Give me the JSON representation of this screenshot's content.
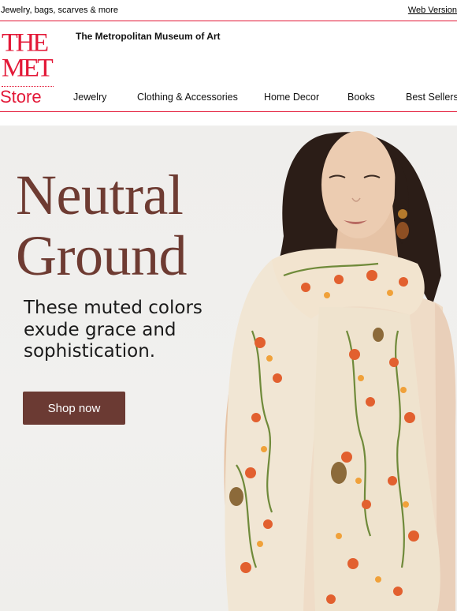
{
  "preheader": {
    "text": "Jewelry, bags, scarves & more",
    "web_version": "Web Version"
  },
  "brand": {
    "logo_line1": "THE",
    "logo_line2": "MET",
    "logo_store": "Store",
    "museum_name": "The Metropolitan Museum of Art",
    "accent_color": "#e31837"
  },
  "nav": {
    "items": [
      "Jewelry",
      "Clothing & Accessories",
      "Home Decor",
      "Books",
      "Best Sellers"
    ]
  },
  "hero": {
    "headline_line1": "Neutral",
    "headline_line2": "Ground",
    "subcopy": "These muted colors exude grace and sophistication.",
    "cta_label": "Shop now",
    "headline_color": "#6e3b32",
    "cta_color": "#6b3a33"
  }
}
